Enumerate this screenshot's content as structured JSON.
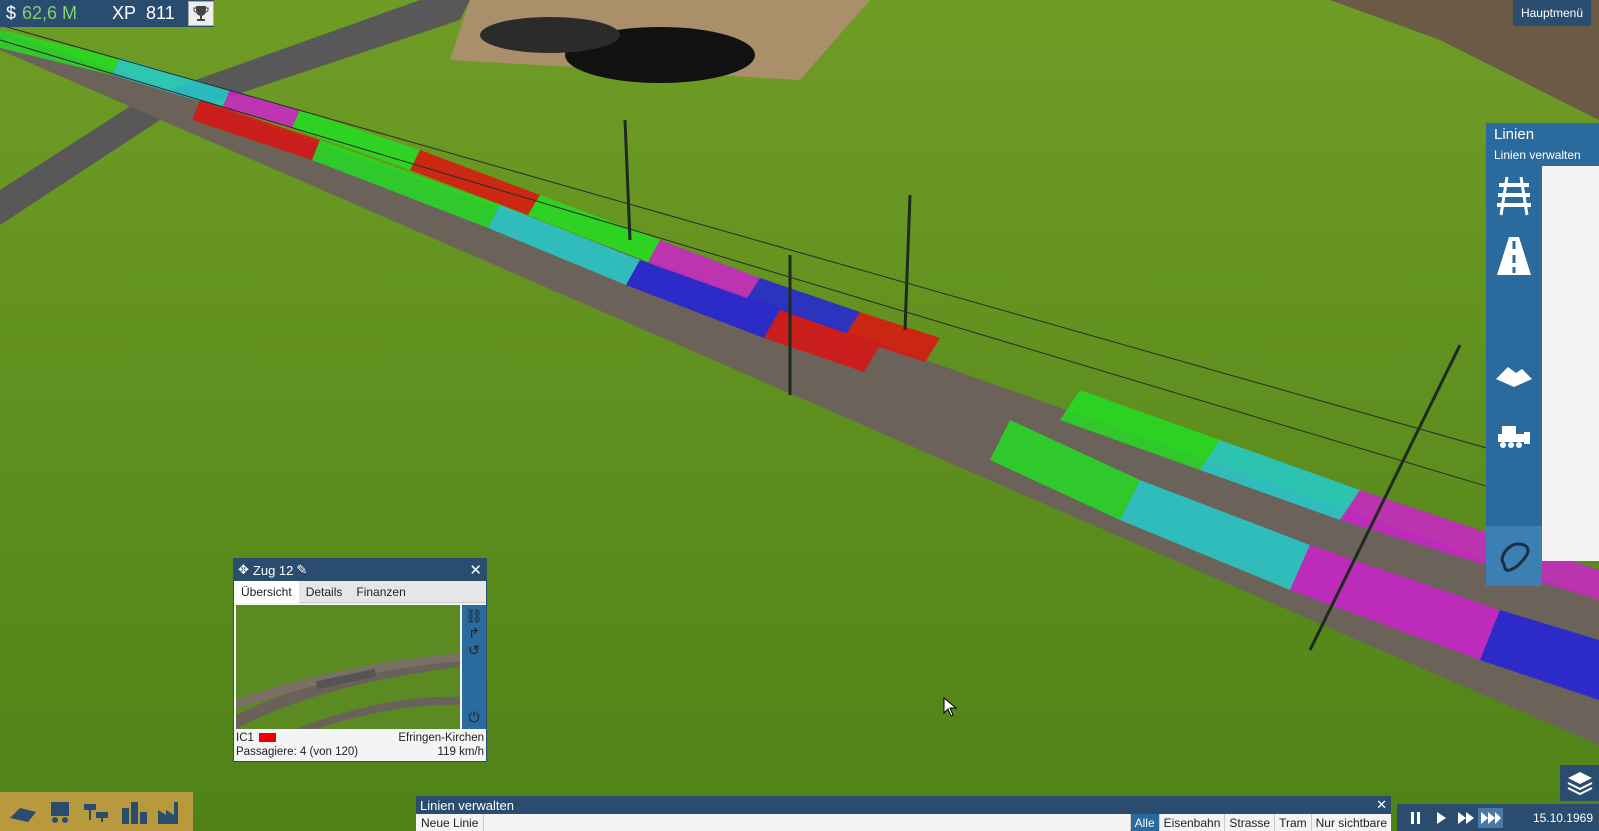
{
  "status": {
    "currency_symbol": "$",
    "money": "62,6 M",
    "xp_label": "XP",
    "xp_value": "811"
  },
  "main_menu": {
    "label": "Hauptmenü"
  },
  "lines_panel": {
    "title": "Linien",
    "subtitle": "Linien verwalten",
    "tools": [
      "rail-icon",
      "road-icon",
      "terrain-icon",
      "bulldozer-icon",
      "line-tool-icon"
    ]
  },
  "train_window": {
    "title": "Zug 12",
    "tabs": [
      "Übersicht",
      "Details",
      "Finanzen"
    ],
    "active_tab": "Übersicht",
    "line": "IC1",
    "line_color": "#e00000",
    "destination": "Efringen-Kirchen",
    "passengers": "Passagiere: 4 (von 120)",
    "speed": "119 km/h"
  },
  "line_manager": {
    "title": "Linien verwalten",
    "new_line": "Neue Linie",
    "filters": [
      "Alle",
      "Eisenbahn",
      "Strasse",
      "Tram",
      "Nur sichtbare"
    ],
    "active_filter": "Alle"
  },
  "game_speed": {
    "date": "15.10.1969",
    "active": "fast-forward-3"
  },
  "colors": {
    "ui_blue": "#2a4c6e",
    "ui_accent": "#2a6a9c",
    "money_green": "#7fd36f",
    "build_bar": "#b89a3c"
  }
}
